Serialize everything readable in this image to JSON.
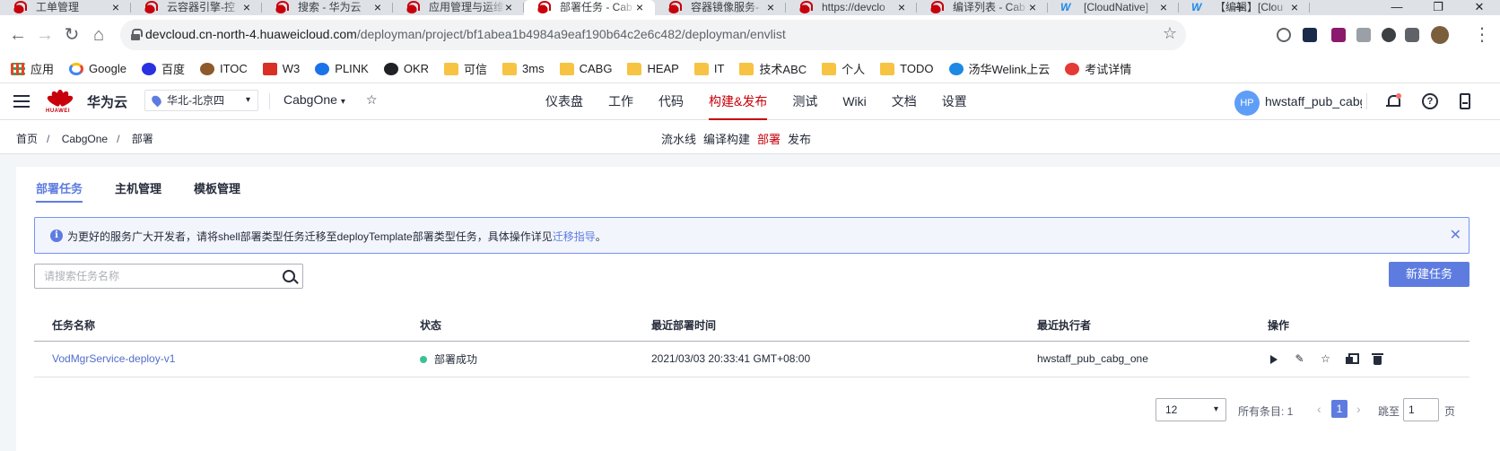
{
  "browser": {
    "tabs": [
      {
        "title": "工单管理",
        "icon": "huawei-icon",
        "active": false
      },
      {
        "title": "云容器引擎-控",
        "icon": "huawei-icon",
        "active": false
      },
      {
        "title": "搜索 - 华为云",
        "icon": "huawei-icon",
        "active": false
      },
      {
        "title": "应用管理与运维",
        "icon": "huawei-icon",
        "active": false
      },
      {
        "title": "部署任务 - Cab",
        "icon": "huawei-icon",
        "active": true
      },
      {
        "title": "容器镜像服务-",
        "icon": "huawei-icon",
        "active": false
      },
      {
        "title": "https://devclo",
        "icon": "huawei-icon",
        "active": false
      },
      {
        "title": "编译列表 - Cab",
        "icon": "huawei-icon",
        "active": false
      },
      {
        "title": "[CloudNative]",
        "icon": "welink-icon",
        "active": false
      },
      {
        "title": "【编辑】[Clou",
        "icon": "welink-icon",
        "active": false
      }
    ],
    "url_host": "devcloud.cn-north-4.huaweicloud.com",
    "url_path": "/deployman/project/bf1abea1b4984a9eaf190b64c2e6c482/deployman/envlist",
    "bookmarks": [
      {
        "label": "应用",
        "icon": "apps-grid-icon"
      },
      {
        "label": "Google",
        "icon": "google-icon"
      },
      {
        "label": "百度",
        "icon": "baidu-icon"
      },
      {
        "label": "ITOC",
        "icon": "itoc-icon"
      },
      {
        "label": "W3",
        "icon": "w3-icon"
      },
      {
        "label": "PLINK",
        "icon": "plink-icon"
      },
      {
        "label": "OKR",
        "icon": "okr-icon"
      },
      {
        "label": "可信",
        "icon": "folder-icon"
      },
      {
        "label": "3ms",
        "icon": "folder-icon"
      },
      {
        "label": "CABG",
        "icon": "folder-icon"
      },
      {
        "label": "HEAP",
        "icon": "folder-icon"
      },
      {
        "label": "IT",
        "icon": "folder-icon"
      },
      {
        "label": "技术ABC",
        "icon": "folder-icon"
      },
      {
        "label": "个人",
        "icon": "folder-icon"
      },
      {
        "label": "TODO",
        "icon": "folder-icon"
      },
      {
        "label": "汤华Welink上云",
        "icon": "welink-icon"
      },
      {
        "label": "考试详情",
        "icon": "exam-icon"
      }
    ]
  },
  "header": {
    "logo_text": "HUAWEI",
    "brand": "华为云",
    "region": "华北-北京四",
    "project": "CabgOne",
    "nav": [
      {
        "label": "仪表盘",
        "active": false
      },
      {
        "label": "工作",
        "active": false
      },
      {
        "label": "代码",
        "active": false
      },
      {
        "label": "构建&发布",
        "active": true
      },
      {
        "label": "测试",
        "active": false
      },
      {
        "label": "Wiki",
        "active": false
      },
      {
        "label": "文档",
        "active": false
      },
      {
        "label": "设置",
        "active": false
      }
    ],
    "avatar_initials": "HP",
    "username": "hwstaff_pub_cabg_one"
  },
  "breadcrumb": [
    "首页",
    "CabgOne",
    "部署"
  ],
  "breadcrumb_sep": "/",
  "subnav": [
    {
      "label": "流水线",
      "active": false
    },
    {
      "label": "编译构建",
      "active": false
    },
    {
      "label": "部署",
      "active": true
    },
    {
      "label": "发布",
      "active": false
    }
  ],
  "tabs": [
    {
      "label": "部署任务",
      "active": true
    },
    {
      "label": "主机管理",
      "active": false
    },
    {
      "label": "模板管理",
      "active": false
    }
  ],
  "notice": {
    "text": "为更好的服务广大开发者，请将shell部署类型任务迁移至deployTemplate部署类型任务，具体操作详见",
    "link": "迁移指导",
    "suffix": "。"
  },
  "search": {
    "placeholder": "请搜索任务名称"
  },
  "new_button": "新建任务",
  "table": {
    "columns": [
      "任务名称",
      "状态",
      "最近部署时间",
      "最近执行者",
      "操作"
    ],
    "rows": [
      {
        "name": "VodMgrService-deploy-v1",
        "status": "部署成功",
        "time": "2021/03/03 20:33:41 GMT+08:00",
        "executor": "hwstaff_pub_cabg_one"
      }
    ]
  },
  "pager": {
    "page_size": "12",
    "total_label": "所有条目: 1",
    "current": "1",
    "jump_label": "跳至",
    "jump_value": "1",
    "page_suffix": "页"
  },
  "colors": {
    "accent": "#5e7ce0",
    "brand_red": "#c7000b",
    "success": "#3ac295"
  }
}
